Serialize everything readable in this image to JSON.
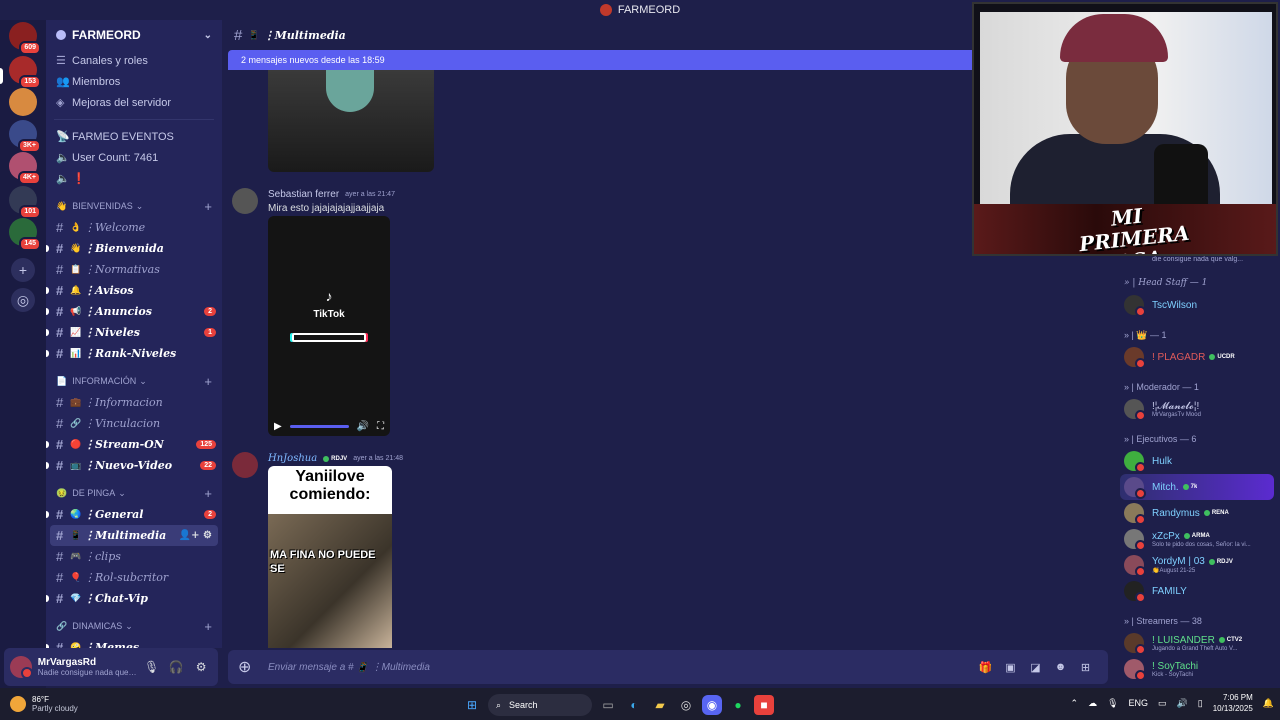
{
  "window": {
    "title": "FARMEORD"
  },
  "rail": {
    "servers": [
      {
        "badge": "609",
        "color": "#8a2020"
      },
      {
        "badge": "153",
        "color": "#a82a2a"
      },
      {
        "badge": "",
        "color": "#d88a40"
      },
      {
        "badge": "3K+",
        "color": "#3a4a8a"
      },
      {
        "badge": "4K+",
        "color": "#b05070"
      },
      {
        "badge": "101",
        "color": "#333a55"
      },
      {
        "badge": "145",
        "color": "#2a6a3a"
      }
    ]
  },
  "sidebar": {
    "guild_name": "FARMEORD",
    "nav": [
      {
        "label": "Canales y roles"
      },
      {
        "label": "Miembros"
      },
      {
        "label": "Mejoras del servidor"
      }
    ],
    "events": [
      {
        "label": "FARMEO EVENTOS"
      },
      {
        "label": "User Count: 7461"
      },
      {
        "label": "❗"
      }
    ],
    "categories": [
      {
        "name": "BIENVENIDAS",
        "emoji": "👋",
        "channels": [
          {
            "name": "Welcome",
            "emoji": "👌",
            "unread": false,
            "count": ""
          },
          {
            "name": "Bienvenida",
            "emoji": "👋",
            "unread": true,
            "count": ""
          },
          {
            "name": "Normativas",
            "emoji": "📋",
            "unread": false,
            "count": ""
          },
          {
            "name": "Avisos",
            "emoji": "🔔",
            "unread": true,
            "count": ""
          },
          {
            "name": "Anuncios",
            "emoji": "📢",
            "unread": true,
            "count": "2"
          },
          {
            "name": "Niveles",
            "emoji": "📈",
            "unread": true,
            "count": "1"
          },
          {
            "name": "Rank-Niveles",
            "emoji": "📊",
            "unread": true,
            "count": ""
          }
        ]
      },
      {
        "name": "INFORMACIÓN",
        "emoji": "📄",
        "channels": [
          {
            "name": "Informacion",
            "emoji": "💼",
            "unread": false,
            "count": ""
          },
          {
            "name": "Vinculacion",
            "emoji": "🔗",
            "unread": false,
            "count": ""
          },
          {
            "name": "Stream-ON",
            "emoji": "🔴",
            "unread": true,
            "count": "125"
          },
          {
            "name": "Nuevo-Video",
            "emoji": "📺",
            "unread": true,
            "count": "22"
          }
        ]
      },
      {
        "name": "DE PINGA",
        "emoji": "🤢",
        "channels": [
          {
            "name": "General",
            "emoji": "🌏",
            "unread": true,
            "count": "2"
          },
          {
            "name": "Multimedia",
            "emoji": "📱",
            "unread": false,
            "count": "",
            "active": true
          },
          {
            "name": "clips",
            "emoji": "🎮",
            "unread": false,
            "count": ""
          },
          {
            "name": "Rol-subcritor",
            "emoji": "🎈",
            "unread": false,
            "count": ""
          },
          {
            "name": "Chat-Vip",
            "emoji": "💎",
            "unread": true,
            "count": ""
          }
        ]
      },
      {
        "name": "DINAMICAS",
        "emoji": "🔗",
        "channels": [
          {
            "name": "Memes",
            "emoji": "🤪",
            "unread": true,
            "count": ""
          }
        ]
      }
    ]
  },
  "user_panel": {
    "name": "MrVargasRd",
    "status": "Nadie consigue nada que va..."
  },
  "channel": {
    "name": "Multimedia",
    "new_messages": "2 mensajes nuevos desde las 18:59"
  },
  "messages": [
    {
      "author": "Sebastian ferrer",
      "timestamp": "ayer a las 21:47",
      "text": "Mira esto jajajajajajjaajjaja",
      "author_color": "#c5c8e8"
    },
    {
      "author": "HnJoshua",
      "timestamp": "ayer a las 21:48",
      "tag": "RDJV",
      "author_color": "#7fb8ff"
    }
  ],
  "tiktok": {
    "logo": "♪",
    "label": "TikTok"
  },
  "meme": {
    "caption": "Yaniilove comiendo:",
    "overlay": "MA FINA NO PUEDE SE"
  },
  "composer": {
    "placeholder": "Enviar mensaje a # 📱 ⋮Multimedia"
  },
  "webcam": {
    "brand": "MI PRIMERA CASA"
  },
  "members": {
    "cut_status": "die consigue nada que valg...",
    "groups": [
      {
        "title": "» | Head Staff — 1",
        "italic": true,
        "members": [
          {
            "name": "TscWilson",
            "color": "#7fd0ff",
            "sub": "",
            "tag": "",
            "av": "#333"
          }
        ]
      },
      {
        "title": "» | 👑 — 1",
        "italic": false,
        "members": [
          {
            "name": "! PLAGADR",
            "color": "#e05a5a",
            "sub": "",
            "tag": "UCDR",
            "av": "#6a3a2a"
          }
        ]
      },
      {
        "title": "» | Moderador — 1",
        "italic": false,
        "members": [
          {
            "name": "!¦𝓜𝓪𝓷𝓮𝓵𝓸¦!",
            "color": "#c5c8e8",
            "sub": "MrVargasTv Mood",
            "tag": "",
            "av": "#555"
          }
        ]
      },
      {
        "title": "» | Ejecutivos — 6",
        "italic": false,
        "members": [
          {
            "name": "Hulk",
            "color": "#7fd0ff",
            "sub": "",
            "tag": "",
            "av": "#3fae3f"
          },
          {
            "name": "Mitch.",
            "color": "#7fd0ff",
            "sub": "",
            "tag": "7k",
            "av": "#5a4a8a",
            "highlight": true
          },
          {
            "name": "Randymus",
            "color": "#7fd0ff",
            "sub": "",
            "tag": "RENA",
            "av": "#8a7a5a"
          },
          {
            "name": "xZcPx",
            "color": "#7fd0ff",
            "sub": "Solo te pido dos cosas, Señor: la vi...",
            "tag": "ARMA",
            "av": "#777"
          },
          {
            "name": "YordyM | 03",
            "color": "#7fd0ff",
            "sub": "👏August 21-25",
            "tag": "RDJV",
            "av": "#8a4a5a"
          },
          {
            "name": "FAMILY",
            "color": "#7fd0ff",
            "sub": "",
            "tag": "",
            "av": "#222"
          }
        ]
      },
      {
        "title": "» | Streamers — 38",
        "italic": false,
        "members": [
          {
            "name": "! LUISANDER",
            "color": "#5fe08a",
            "sub": "Jugando a Grand Theft Auto V...",
            "tag": "CTV2",
            "av": "#5a3a2a"
          },
          {
            "name": "! SoyTachi",
            "color": "#5fe08a",
            "sub": "Kick - SoyTachi",
            "tag": "",
            "av": "#a05a6a"
          }
        ]
      }
    ]
  },
  "taskbar": {
    "temp": "86°F",
    "weather": "Partly cloudy",
    "search": "Search",
    "lang": "ENG",
    "time": "7:06 PM",
    "date": "10/13/2025"
  }
}
